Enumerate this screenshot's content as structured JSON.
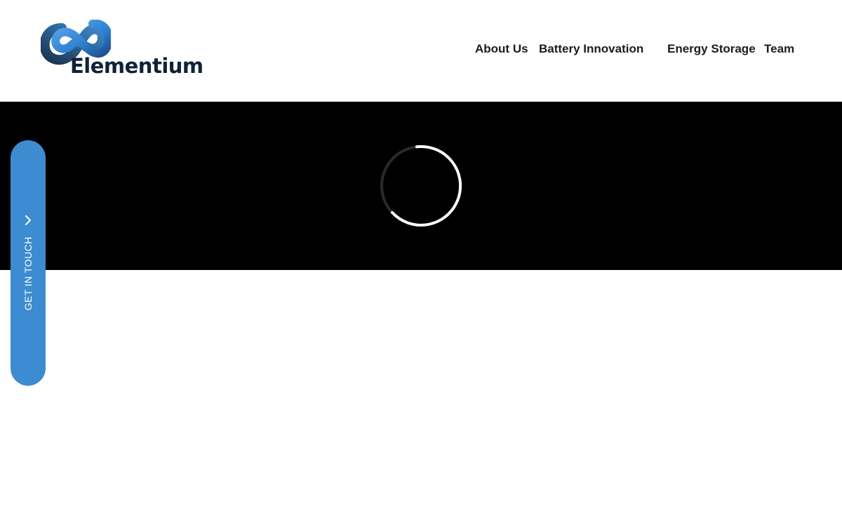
{
  "brand": {
    "name": "Elementium",
    "logo_icon": "infinity-logo-icon",
    "colors": {
      "logo_blue": "#2f7fd0",
      "logo_dark": "#0f2236"
    }
  },
  "nav": {
    "items": [
      {
        "label": "About Us"
      },
      {
        "label": "Battery Innovation"
      },
      {
        "label": "Energy Storage"
      },
      {
        "label": "Team"
      }
    ]
  },
  "hero": {
    "background": "#000000",
    "loading_icon": "loading-spinner-icon"
  },
  "cta": {
    "label": "GET IN TOUCH",
    "icon": "chevron-right-icon",
    "color": "#3d8bd0"
  }
}
